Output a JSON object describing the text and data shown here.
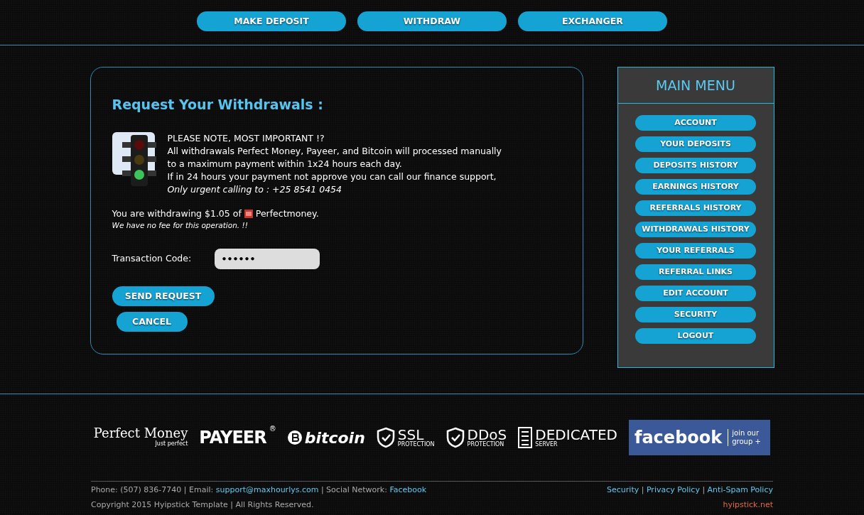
{
  "top_nav": [
    {
      "label": "MAKE DEPOSIT"
    },
    {
      "label": "WITHDRAW"
    },
    {
      "label": "EXCHANGER"
    }
  ],
  "withdraw": {
    "title": "Request Your Withdrawals :",
    "notice": {
      "lines": [
        "PLEASE NOTE, MOST IMPORTANT !?",
        "All withdrawals Perfect Money, Payeer, and Bitcoin will processed manually",
        "to a maximum payment within 1x24 hours each day.",
        "If in 24 hours your payment not approve you can call our finance support,"
      ],
      "italic_line": "Only urgent calling to : +25 8541 0454"
    },
    "amount_text": "You are withdrawing $1.05 of",
    "processor": "Perfectmoney.",
    "fee_note": "We have no fee for this operation. !!",
    "field": {
      "label": "Transaction Code:",
      "value": "••••••"
    },
    "buttons": [
      "SEND REQUEST",
      "CANCEL"
    ]
  },
  "main_menu": {
    "title": "MAIN MENU",
    "items": [
      "ACCOUNT",
      "YOUR DEPOSITS",
      "DEPOSITS HISTORY",
      "EARNINGS HISTORY",
      "REFERRALS HISTORY",
      "WITHDRAWALS HISTORY",
      "YOUR REFERRALS",
      "REFERRAL LINKS",
      "EDIT ACCOUNT",
      "SECURITY",
      "LOGOUT"
    ]
  },
  "logos": [
    {
      "kind": "perfectmoney",
      "title": "Perfect Money",
      "sub": "Just perfect"
    },
    {
      "kind": "payeer",
      "title": "PAYEER",
      "sub": "®"
    },
    {
      "kind": "bitcoin",
      "title": "bitcoin"
    },
    {
      "kind": "shield",
      "title": "SSL",
      "sub": "PROTECTION"
    },
    {
      "kind": "shield",
      "title": "DDoS",
      "sub": "PROTECTION"
    },
    {
      "kind": "server",
      "title": "DEDICATED",
      "sub": "SERVER"
    },
    {
      "kind": "facebook",
      "title": "facebook",
      "sub": "join our group +"
    }
  ],
  "footer": {
    "contact": [
      {
        "kind": "text",
        "text": "Phone: (507) 836-7740 | Email: "
      },
      {
        "kind": "link",
        "text": "support@maxhourlys.com"
      },
      {
        "kind": "text",
        "text": " | Social Network: "
      },
      {
        "kind": "link",
        "text": "Facebook"
      }
    ],
    "copyright": "Copyright 2015 Hyipstick Template | All Rights Reserved.",
    "policies": [
      "Security",
      "Privacy Policy",
      "Anti-Spam Policy"
    ],
    "separator": "|",
    "credit": "hyipstick.net"
  }
}
